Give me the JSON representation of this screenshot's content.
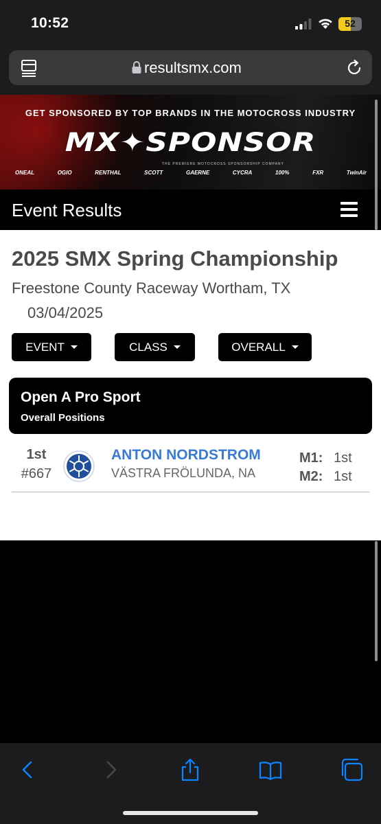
{
  "status": {
    "time": "10:52",
    "battery": "52",
    "battery_level": 0.52
  },
  "browser": {
    "url": "resultsmx.com"
  },
  "banner": {
    "tagline": "GET SPONSORED BY TOP BRANDS IN THE MOTOCROSS INDUSTRY",
    "logo": "MX✦SPONSOR",
    "logo_sub": "THE PREMIERE MOTOCROSS SPONSORSHIP COMPANY",
    "brands": [
      "ONEAL",
      "OGIO",
      "RENTHAL",
      "SCOTT",
      "GAERNE",
      "CYCRA",
      "100%",
      "FXR",
      "TwinAir"
    ]
  },
  "header": {
    "title": "Event Results"
  },
  "event": {
    "title": "2025 SMX Spring Championship",
    "venue": "Freestone County Raceway Wortham, TX",
    "date": "03/04/2025"
  },
  "filters": {
    "event_label": "EVENT",
    "class_label": "CLASS",
    "overall_label": "OVERALL"
  },
  "class_card": {
    "name": "Open A Pro Sport",
    "subtitle": "Overall Positions"
  },
  "results": [
    {
      "position": "1st",
      "number": "#667",
      "name": "ANTON NORDSTROM",
      "hometown": "VÄSTRA FRÖLUNDA, NA",
      "m1_label": "M1:",
      "m1": "1st",
      "m2_label": "M2:",
      "m2": "1st",
      "brand_icon": "yamaha-logo-icon"
    }
  ],
  "colors": {
    "link_blue": "#3a7bd5",
    "battery_yellow": "#f5cb1b",
    "banner_red": "#c81414"
  }
}
